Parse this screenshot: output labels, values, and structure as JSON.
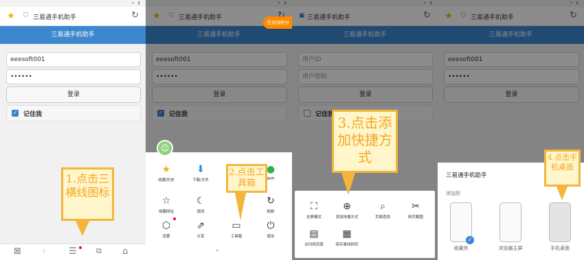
{
  "app_title": "三易通手机助手",
  "login": {
    "username": "eeesoft001",
    "password": "••••••",
    "username_placeholder": "用户ID",
    "password_placeholder": "用户密码",
    "login_button": "登录",
    "remember_me": "记住我"
  },
  "panel2": {
    "promo_badge": "签到领积分",
    "menu_items": [
      {
        "label": "收藏/历史",
        "icon": "star-icon"
      },
      {
        "label": "下载/文件",
        "icon": "download-icon"
      },
      {
        "label": "WiFi",
        "icon": "wifi-icon"
      },
      {
        "label": "收藏网址",
        "icon": "bookmark-star-icon"
      },
      {
        "label": "夜间",
        "icon": "moon-icon"
      },
      {
        "label": "刷新",
        "icon": "refresh-icon"
      },
      {
        "label": "设置",
        "icon": "settings-icon"
      },
      {
        "label": "分享",
        "icon": "share-icon"
      },
      {
        "label": "工具箱",
        "icon": "toolbox-icon"
      },
      {
        "label": "退出",
        "icon": "power-icon"
      }
    ]
  },
  "panel3": {
    "tools": [
      {
        "label": "全屏模式",
        "icon": "fullscreen-icon"
      },
      {
        "label": "添加快捷方式",
        "icon": "add-circle-icon"
      },
      {
        "label": "页面查找",
        "icon": "search-icon"
      },
      {
        "label": "网页截图",
        "icon": "scissors-icon"
      },
      {
        "label": "访问网页版",
        "icon": "web-icon"
      },
      {
        "label": "保存离线网页",
        "icon": "save-page-icon"
      }
    ]
  },
  "panel4": {
    "dialog_title": "三易通手机助手",
    "add_to_label": "添加到",
    "targets": [
      "收藏夹",
      "浏览器主屏",
      "手机桌面"
    ]
  },
  "callouts": {
    "step1": "1.点击三横线图标",
    "step2": "2.点击工具箱",
    "step3": "3.点击添加快捷方式",
    "step4": "4.点击手机桌面"
  },
  "colors": {
    "header_blue": "#3d87cf",
    "callout_orange": "#f5a623",
    "callout_fill": "#fff6cc",
    "star_yellow": "#f4b400"
  }
}
